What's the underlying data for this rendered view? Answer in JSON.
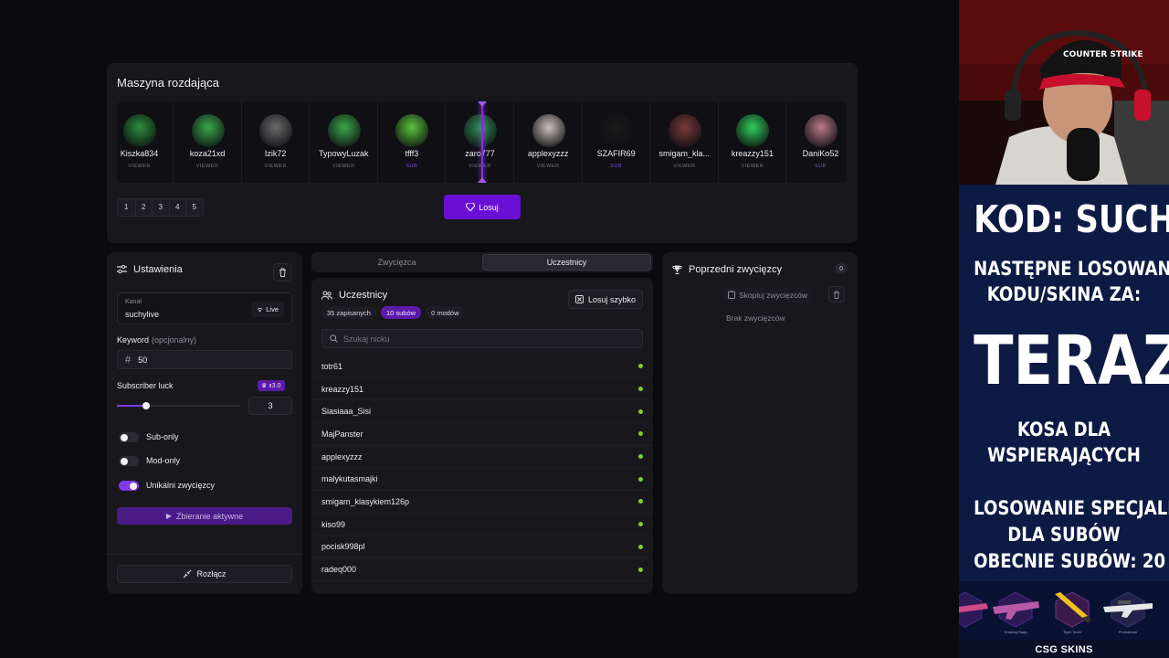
{
  "machine": {
    "title": "Maszyna rozdająca",
    "cards": [
      {
        "name": "Kiszka834",
        "role": "VIEWER",
        "sub": false,
        "color": "#2a8f3a"
      },
      {
        "name": "koza21xd",
        "role": "VIEWER",
        "sub": false,
        "color": "#3aa84a"
      },
      {
        "name": "Izik72",
        "role": "VIEWER",
        "sub": false,
        "color": "#6b6b6b"
      },
      {
        "name": "TypowyLuzak",
        "role": "VIEWER",
        "sub": false,
        "color": "#3aa84a"
      },
      {
        "name": "tfff3",
        "role": "SUB",
        "sub": true,
        "color": "#58c43a"
      },
      {
        "name": "zaro777",
        "role": "VIEWER",
        "sub": false,
        "color": "#2f8f55"
      },
      {
        "name": "applexyzzz",
        "role": "VIEWER",
        "sub": false,
        "color": "#c9c2b8"
      },
      {
        "name": "SZAFIR69",
        "role": "SUB",
        "sub": true,
        "color": "#1a1a1a"
      },
      {
        "name": "smigam_kla...",
        "role": "VIEWER",
        "sub": false,
        "color": "#7a3a3a"
      },
      {
        "name": "kreazzy151",
        "role": "VIEWER",
        "sub": false,
        "color": "#2ecf5a"
      },
      {
        "name": "DaniKo52",
        "role": "SUB",
        "sub": true,
        "color": "#b87a8a"
      }
    ],
    "pages": [
      "1",
      "2",
      "3",
      "4",
      "5"
    ],
    "draw_label": "Losuj"
  },
  "settings": {
    "title": "Ustawienia",
    "channel_label": "Kanał",
    "channel_value": "suchylive",
    "live_label": "Live",
    "keyword_label": "Keyword",
    "keyword_hint": "(opcjonalny)",
    "keyword_value": "50",
    "luck_label": "Subscriber luck",
    "luck_multiplier": "x3.0",
    "luck_value": "3",
    "toggles": [
      {
        "label": "Sub-only",
        "on": false
      },
      {
        "label": "Mod-only",
        "on": false
      },
      {
        "label": "Unikalni zwycięzcy",
        "on": true
      }
    ],
    "collect_label": "Zbieranie aktywne",
    "disconnect_label": "Rozłącz"
  },
  "tabs": [
    "Zwycięzca",
    "Uczestnicy"
  ],
  "participants": {
    "title": "Uczestnicy",
    "quick_label": "Losuj szybko",
    "badges": [
      "35 zapisanych",
      "10 subów",
      "0 modów"
    ],
    "search_placeholder": "Szukaj nicku",
    "list": [
      "totr61",
      "kreazzy151",
      "Siasiaaa_Sisi",
      "MajPanster",
      "applexyzzz",
      "malykutasmajki",
      "smigam_klasykiem126p",
      "kiso99",
      "pocisk998pl",
      "radeq000"
    ]
  },
  "previous": {
    "title": "Poprzedni zwycięzcy",
    "count": "0",
    "copy_label": "Skopiuj zwycięzców",
    "empty_label": "Brak zwycięzców"
  },
  "stream": {
    "cap_logo": "COUNTER STRIKE",
    "line1": "KOD: SUCHY",
    "line2": "NASTĘPNE LOSOWANIE",
    "line3": "KODU/SKINA ZA:",
    "line4": "TERAZ",
    "line5": "KOSA DLA",
    "line6": "WSPIERAJĄCYCH",
    "line7": "LOSOWANIE SPECJALNE",
    "line8": "DLA SUBÓW",
    "line9": "OBECNIE SUBÓW: 20",
    "skins": [
      "Snaking Rags",
      "Tiger Tooth",
      "Printstream"
    ],
    "brand": "CSG SKINS"
  },
  "colors": {
    "accent": "#6a0fd6",
    "panel": "#18171c",
    "background": "#0b0a0e",
    "online": "#7ad130"
  }
}
